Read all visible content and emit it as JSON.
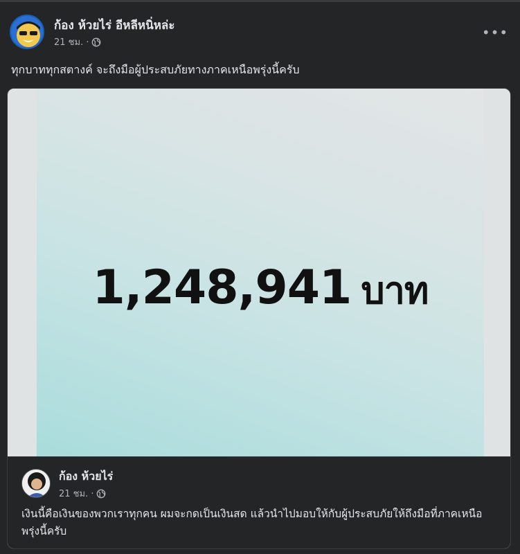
{
  "post": {
    "author": "ก้อง ห้วยไร่ อีหลีหนิ่หล่ะ",
    "time": "21 ชม. ·",
    "privacy_icon": "globe-icon",
    "more_label": "•••",
    "text": "ทุกบาททุกสตางค์ จะถึงมือผู้ประสบภัยทางภาคเหนือพรุ่งนี้ครับ"
  },
  "image": {
    "amount": "1,248,941",
    "unit": "บาท"
  },
  "shared_post": {
    "author": "ก้อง ห้วยไร่",
    "time": "21 ชม. ·",
    "privacy_icon": "globe-icon",
    "text": "เงินนี้คือเงินของพวกเราทุกคน ผมจะกดเป็นเงินสด แล้วนำไปมอบให้กับผู้ประสบภัยให้ถึงมือที่ภาคเหนือพรุ่งนี้ครับ"
  },
  "colors": {
    "background": "#242526",
    "text": "#e4e6eb",
    "secondary_text": "#b0b3b8"
  }
}
